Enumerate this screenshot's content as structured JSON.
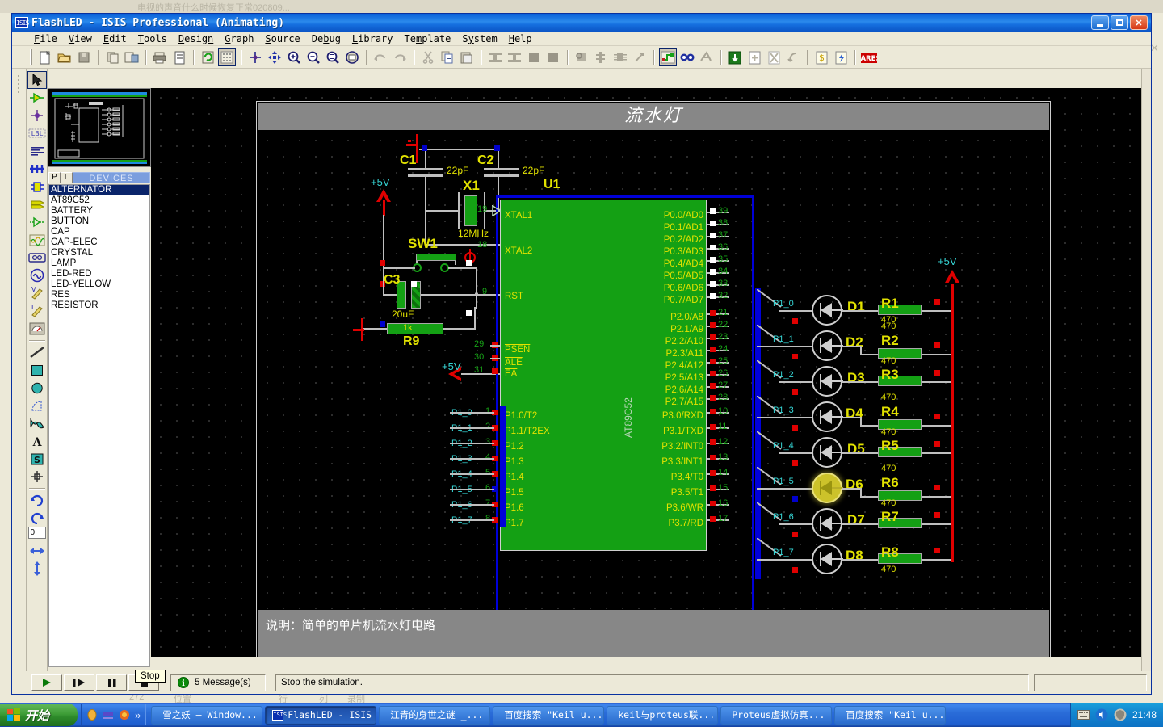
{
  "window": {
    "title": "FlashLED - ISIS Professional (Animating)",
    "icon": "isis-icon",
    "minimize_label": "Minimize",
    "maximize_label": "Maximize",
    "close_label": "Close"
  },
  "background_window": {
    "title": "电视的声音什么时候恢复正常020809..."
  },
  "menu": [
    {
      "label": "File",
      "accel": "F"
    },
    {
      "label": "View",
      "accel": "V"
    },
    {
      "label": "Edit",
      "accel": "E"
    },
    {
      "label": "Tools",
      "accel": "T"
    },
    {
      "label": "Design",
      "accel": "D"
    },
    {
      "label": "Graph",
      "accel": "G"
    },
    {
      "label": "Source",
      "accel": "S"
    },
    {
      "label": "Debug",
      "accel": "b"
    },
    {
      "label": "Library",
      "accel": "L"
    },
    {
      "label": "Template",
      "accel": "m"
    },
    {
      "label": "System",
      "accel": "y"
    },
    {
      "label": "Help",
      "accel": "H"
    }
  ],
  "toolbar": {
    "groups": [
      [
        "new-file-icon",
        "open-file-icon",
        "save-file-icon"
      ],
      [
        "import-section-icon",
        "export-section-icon"
      ],
      [
        "print-icon",
        "print-area-icon"
      ],
      [
        "refresh-icon",
        "toggle-grid-icon"
      ],
      [
        "origin-icon",
        "pan-icon",
        "zoom-in-icon",
        "zoom-out-icon",
        "zoom-area-icon",
        "zoom-sheet-icon"
      ],
      [
        "undo-icon",
        "redo-icon"
      ],
      [
        "cut-icon",
        "copy-icon",
        "paste-icon"
      ],
      [
        "copy-block-icon",
        "move-block-icon",
        "rotate-block-icon",
        "delete-block-icon"
      ],
      [
        "pick-device-icon",
        "make-device-icon",
        "packaging-tool-icon",
        "decompose-icon"
      ],
      [
        "wire-autorouter-icon",
        "search-tag-icon",
        "property-assignment-icon"
      ],
      [
        "design-explorer-icon",
        "new-sheet-icon",
        "remove-sheet-icon",
        "exit-sheet-icon"
      ],
      [
        "bill-of-materials-icon",
        "electrical-rule-check-icon"
      ],
      [
        "netlist-to-ares-icon"
      ]
    ],
    "ares_label": "ARES"
  },
  "mode_toolbar": [
    {
      "name": "selection-mode-icon",
      "selected": true
    },
    {
      "name": "component-mode-icon",
      "selected": false
    },
    {
      "name": "junction-dot-mode-icon",
      "selected": false
    },
    {
      "name": "wire-label-mode-icon",
      "selected": false
    },
    {
      "name": "text-script-mode-icon",
      "selected": false
    },
    {
      "name": "bus-mode-icon",
      "selected": false
    },
    {
      "name": "subcircuit-mode-icon",
      "selected": false
    },
    {
      "name": "terminals-mode-icon",
      "selected": false
    },
    {
      "name": "device-pin-mode-icon",
      "selected": false
    },
    {
      "name": "graph-mode-icon",
      "selected": false
    },
    {
      "name": "tape-recorder-mode-icon",
      "selected": false
    },
    {
      "name": "generator-mode-icon",
      "selected": false
    },
    {
      "name": "voltage-probe-mode-icon",
      "selected": false
    },
    {
      "name": "current-probe-mode-icon",
      "selected": false
    },
    {
      "name": "virtual-instrument-mode-icon",
      "selected": false
    },
    {
      "name": "line-tool-icon",
      "selected": false
    },
    {
      "name": "box-tool-icon",
      "selected": false
    },
    {
      "name": "circle-tool-icon",
      "selected": false
    },
    {
      "name": "arc-tool-icon",
      "selected": false
    },
    {
      "name": "closed-path-tool-icon",
      "selected": false
    },
    {
      "name": "text-tool-icon",
      "selected": false
    },
    {
      "name": "symbol-tool-icon",
      "selected": false
    },
    {
      "name": "marker-tool-icon",
      "selected": false
    },
    {
      "name": "rotate-clockwise-icon",
      "selected": false
    },
    {
      "name": "rotate-anticlockwise-icon",
      "selected": false
    },
    {
      "name": "mirror-horizontal-icon",
      "selected": false
    },
    {
      "name": "mirror-vertical-icon",
      "selected": false
    }
  ],
  "rotation_value": "0",
  "object_selector": {
    "pick_button": "P",
    "library_button": "L",
    "header": "DEVICES",
    "items": [
      {
        "label": "ALTERNATOR",
        "selected": true
      },
      {
        "label": "AT89C52",
        "selected": false
      },
      {
        "label": "BATTERY",
        "selected": false
      },
      {
        "label": "BUTTON",
        "selected": false
      },
      {
        "label": "CAP",
        "selected": false
      },
      {
        "label": "CAP-ELEC",
        "selected": false
      },
      {
        "label": "CRYSTAL",
        "selected": false
      },
      {
        "label": "LAMP",
        "selected": false
      },
      {
        "label": "LED-RED",
        "selected": false
      },
      {
        "label": "LED-YELLOW",
        "selected": false
      },
      {
        "label": "RES",
        "selected": false
      },
      {
        "label": "RESISTOR",
        "selected": false
      }
    ]
  },
  "schematic": {
    "sheet_title": "流水灯",
    "caption": "说明：简单的单片机流水灯电路",
    "mcu": {
      "reference": "U1",
      "part_name": "AT89C52",
      "left_pins": [
        {
          "label": "XTAL1",
          "number": "19"
        },
        {
          "label": "XTAL2",
          "number": "18"
        },
        {
          "label": "RST",
          "number": "9"
        },
        {
          "label": "PSEN",
          "number": "29",
          "overline": true
        },
        {
          "label": "ALE",
          "number": "30",
          "overline": true
        },
        {
          "label": "EA",
          "number": "31",
          "overline": true
        }
      ],
      "p1_pins": [
        {
          "label": "P1.0/T2",
          "number": "1",
          "net": "P1_0"
        },
        {
          "label": "P1.1/T2EX",
          "number": "2",
          "net": "P1_1"
        },
        {
          "label": "P1.2",
          "number": "3",
          "net": "P1_2"
        },
        {
          "label": "P1.3",
          "number": "4",
          "net": "P1_3"
        },
        {
          "label": "P1.4",
          "number": "5",
          "net": "P1_4"
        },
        {
          "label": "P1.5",
          "number": "6",
          "net": "P1_5"
        },
        {
          "label": "P1.6",
          "number": "7",
          "net": "P1_6"
        },
        {
          "label": "P1.7",
          "number": "8",
          "net": "P1_7"
        }
      ],
      "p0_pins": [
        {
          "label": "P0.0/AD0",
          "number": "39"
        },
        {
          "label": "P0.1/AD1",
          "number": "38"
        },
        {
          "label": "P0.2/AD2",
          "number": "37"
        },
        {
          "label": "P0.3/AD3",
          "number": "36"
        },
        {
          "label": "P0.4/AD4",
          "number": "35"
        },
        {
          "label": "P0.5/AD5",
          "number": "34"
        },
        {
          "label": "P0.6/AD6",
          "number": "33"
        },
        {
          "label": "P0.7/AD7",
          "number": "32"
        }
      ],
      "p2_pins": [
        {
          "label": "P2.0/A8",
          "number": "21"
        },
        {
          "label": "P2.1/A9",
          "number": "22"
        },
        {
          "label": "P2.2/A10",
          "number": "23"
        },
        {
          "label": "P2.3/A11",
          "number": "24"
        },
        {
          "label": "P2.4/A12",
          "number": "25"
        },
        {
          "label": "P2.5/A13",
          "number": "26"
        },
        {
          "label": "P2.6/A14",
          "number": "27"
        },
        {
          "label": "P2.7/A15",
          "number": "28"
        }
      ],
      "p3_pins": [
        {
          "label": "P3.0/RXD",
          "number": "10",
          "overline": false
        },
        {
          "label": "P3.1/TXD",
          "number": "11",
          "overline": true
        },
        {
          "label": "P3.2/INT0",
          "number": "12",
          "overline": true
        },
        {
          "label": "P3.3/INT1",
          "number": "13",
          "overline": true
        },
        {
          "label": "P3.4/T0",
          "number": "14",
          "overline": false
        },
        {
          "label": "P3.5/T1",
          "number": "15",
          "overline": false
        },
        {
          "label": "P3.6/WR",
          "number": "16",
          "overline": true
        },
        {
          "label": "P3.7/RD",
          "number": "17",
          "overline": true
        }
      ]
    },
    "components": [
      {
        "ref": "C1",
        "value": "22pF",
        "type": "capacitor"
      },
      {
        "ref": "C2",
        "value": "22pF",
        "type": "capacitor"
      },
      {
        "ref": "X1",
        "value": "12MHz",
        "type": "crystal"
      },
      {
        "ref": "SW1",
        "value": "",
        "type": "button"
      },
      {
        "ref": "C3",
        "value": "20uF",
        "type": "cap-elec"
      },
      {
        "ref": "R9",
        "value": "1k",
        "type": "resistor"
      }
    ],
    "leds": [
      {
        "ref": "D1",
        "resistor": "R1",
        "value": "470",
        "net": "P1_0",
        "lit": false,
        "logic": "high"
      },
      {
        "ref": "D2",
        "resistor": "R2",
        "value": "470",
        "net": "P1_1",
        "lit": false,
        "logic": "high"
      },
      {
        "ref": "D3",
        "resistor": "R3",
        "value": "470",
        "net": "P1_2",
        "lit": false,
        "logic": "high"
      },
      {
        "ref": "D4",
        "resistor": "R4",
        "value": "470",
        "net": "P1_3",
        "lit": false,
        "logic": "high"
      },
      {
        "ref": "D5",
        "resistor": "R5",
        "value": "470",
        "net": "P1_4",
        "lit": false,
        "logic": "high"
      },
      {
        "ref": "D6",
        "resistor": "R6",
        "value": "470",
        "net": "P1_5",
        "lit": true,
        "logic": "low"
      },
      {
        "ref": "D7",
        "resistor": "R7",
        "value": "470",
        "net": "P1_6",
        "lit": false,
        "logic": "high"
      },
      {
        "ref": "D8",
        "resistor": "R8",
        "value": "470",
        "net": "P1_7",
        "lit": false,
        "logic": "high"
      }
    ],
    "power_labels": [
      "+5V",
      "+5V",
      "+5V"
    ]
  },
  "animation_bar": {
    "play_label": "Play",
    "step_label": "Step",
    "pause_label": "Pause",
    "stop_label": "Stop",
    "messages": "5 Message(s)",
    "message_icon": "info-icon",
    "status_text": "Stop the simulation.",
    "tooltip": "Stop"
  },
  "status_faint": {
    "col1": "272",
    "col2": "位置",
    "col3": "行",
    "col4": "列",
    "col5": "录制"
  },
  "taskbar": {
    "start_label": "开始",
    "quick_launch": [
      "show-desktop-icon",
      "media-player-icon",
      "firefox-icon",
      "more-chevron-icon"
    ],
    "tasks": [
      {
        "label": "雪之妖 — Window...",
        "icon": "globe-icon",
        "active": false
      },
      {
        "label": "FlashLED - ISIS ...",
        "icon": "isis-icon",
        "active": true
      },
      {
        "label": "江青的身世之谜 _...",
        "icon": "globe-icon",
        "active": false
      },
      {
        "label": "百度搜索 \"Keil u...",
        "icon": "folder-icon",
        "active": false
      },
      {
        "label": "keil与proteus联...",
        "icon": "document-icon",
        "active": false
      },
      {
        "label": "Proteus虚拟仿真...",
        "icon": "document-icon",
        "active": false
      },
      {
        "label": "百度搜索 \"Keil u...",
        "icon": "document-icon",
        "active": false
      }
    ],
    "tray_icons": [
      "keyboard-icon",
      "volume-icon",
      "security-icon"
    ],
    "clock": "21:48"
  },
  "colors": {
    "accent": "#0a60d8",
    "mcu_body": "#14a014",
    "pin_label": "#e2e200",
    "pin_number": "#17a117",
    "net_label": "#36d6d6",
    "bus": "#0000d8",
    "wire": "#bfbfbf",
    "led_on": "#ccc22a",
    "logic_high": "#e00000",
    "logic_low": "#0000cc"
  }
}
